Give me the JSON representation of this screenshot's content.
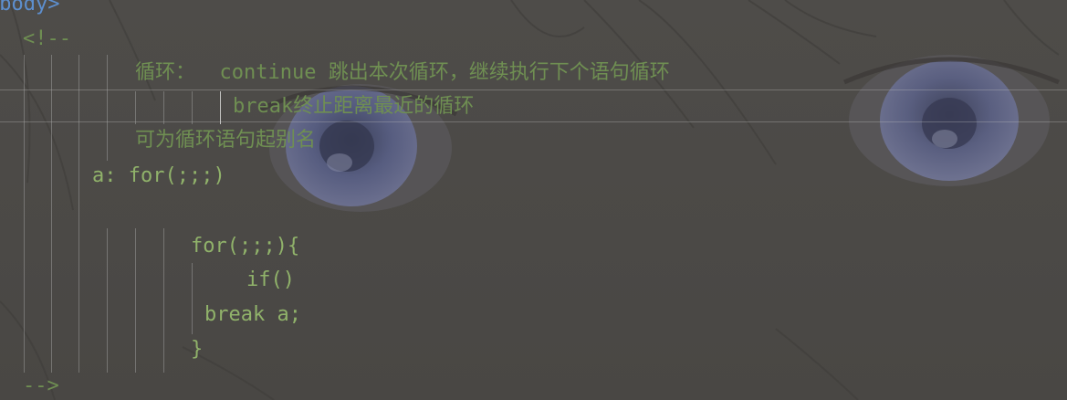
{
  "colors": {
    "tag": "#5d8fcf",
    "comment": "#6f8f52",
    "code": "#90b26a",
    "indent_guide": "#aaaaaa"
  },
  "editor": {
    "lines": {
      "body_tag": "<body>",
      "comment_open": "<!--",
      "loop_heading": "循环：  continue 跳出本次循环，继续执行下个语句循环",
      "break_note": "break终止距离最近的循环",
      "alias_note": "可为循环语句起别名",
      "outer_for": "a: for(;;;)",
      "inner_for": "for(;;;){",
      "if_stmt": "if()",
      "break_stmt": "break a;",
      "close_brace": "}",
      "comment_close": "-->"
    }
  }
}
